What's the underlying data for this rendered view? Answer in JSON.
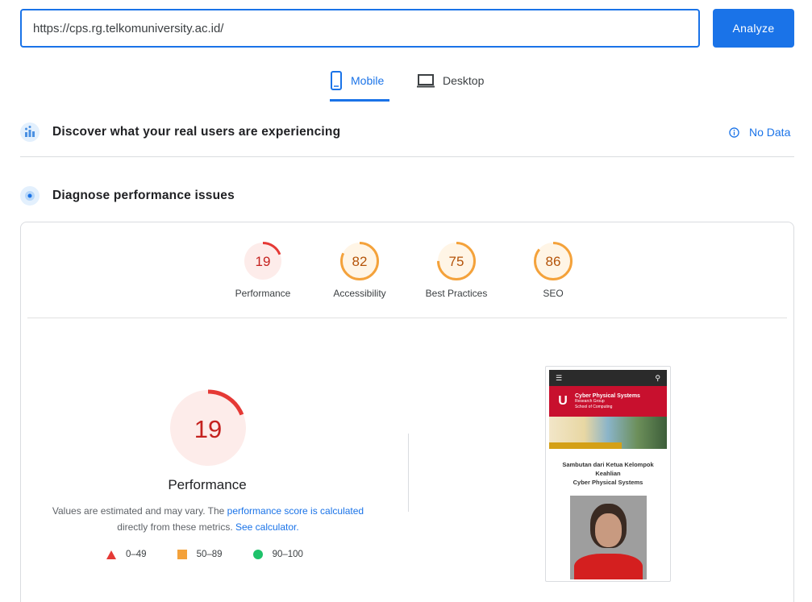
{
  "search": {
    "url": "https://cps.rg.telkomuniversity.ac.id/",
    "analyze_label": "Analyze"
  },
  "tabs": [
    {
      "label": "Mobile",
      "active": true
    },
    {
      "label": "Desktop",
      "active": false
    }
  ],
  "field_data": {
    "title": "Discover what your real users are experiencing",
    "status": "No Data"
  },
  "diagnose": {
    "title": "Diagnose performance issues"
  },
  "scores": [
    {
      "label": "Performance",
      "value": "19",
      "fraction": 0.19,
      "color": "#e53935",
      "bg": "#fdecea",
      "text": "#c5221f"
    },
    {
      "label": "Accessibility",
      "value": "82",
      "fraction": 0.82,
      "color": "#f4a23b",
      "bg": "#fff5e6",
      "text": "#b45309"
    },
    {
      "label": "Best Practices",
      "value": "75",
      "fraction": 0.75,
      "color": "#f4a23b",
      "bg": "#fff5e6",
      "text": "#b45309"
    },
    {
      "label": "SEO",
      "value": "86",
      "fraction": 0.86,
      "color": "#f4a23b",
      "bg": "#fff5e6",
      "text": "#b45309"
    }
  ],
  "performance": {
    "value": "19",
    "fraction": 0.19,
    "title": "Performance",
    "note_before": "Values are estimated and may vary. The ",
    "note_link1": "performance score is calculated",
    "note_middle": " directly from these metrics. ",
    "note_link2": "See calculator."
  },
  "legend": [
    {
      "shape": "triangle",
      "label": "0–49",
      "color": "#e53935"
    },
    {
      "shape": "square",
      "label": "50–89",
      "color": "#f4a23b"
    },
    {
      "shape": "circle",
      "label": "90–100",
      "color": "#1ec26a"
    }
  ],
  "screenshot": {
    "banner_title": "Cyber Physical Systems",
    "banner_sub1": "Research Group",
    "banner_sub2": "School of Computing",
    "caption_line1": "Sambutan dari Ketua Kelompok",
    "caption_line2": "Keahlian",
    "caption_line3": "Cyber Physical Systems"
  }
}
